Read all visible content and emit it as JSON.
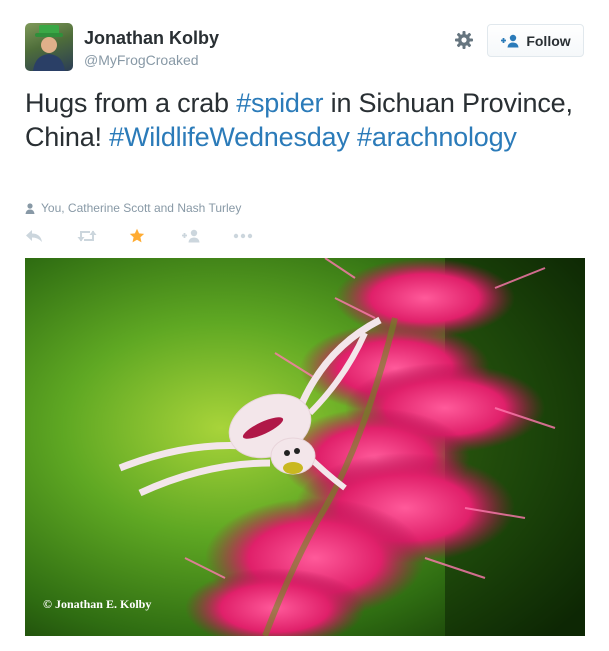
{
  "author": {
    "name": "Jonathan Kolby",
    "handle": "@MyFrogCroaked"
  },
  "follow_button": {
    "label": "Follow"
  },
  "tweet": {
    "segments": [
      {
        "text": "Hugs from a crab ",
        "hashtag": false
      },
      {
        "text": "#spider",
        "hashtag": true
      },
      {
        "text": " in Sichuan Province, China! ",
        "hashtag": false
      },
      {
        "text": "#WildlifeWednesday",
        "hashtag": true
      },
      {
        "text": " ",
        "hashtag": false
      },
      {
        "text": "#arachnology",
        "hashtag": true
      }
    ],
    "favorited_by": "You, Catherine Scott and Nash Turley"
  },
  "actions": [
    {
      "name": "reply-icon",
      "active": false
    },
    {
      "name": "retweet-icon",
      "active": false
    },
    {
      "name": "favorite-icon",
      "active": true
    },
    {
      "name": "follow-icon",
      "active": false
    },
    {
      "name": "more-icon",
      "active": false
    }
  ],
  "media": {
    "credit": "© Jonathan E. Kolby"
  },
  "colors": {
    "hashtag": "#2b7bb9",
    "favorite_active": "#ffac33",
    "icon_muted": "#ccd6dd",
    "text_muted": "#8899a6"
  }
}
